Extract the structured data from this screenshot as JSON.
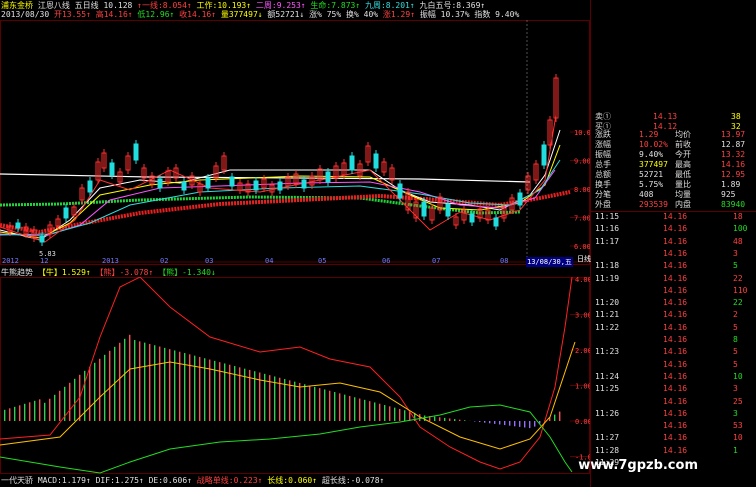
{
  "header": {
    "line1": [
      {
        "t": "浦东金桥",
        "c": "yel"
      },
      {
        "t": " 江恩八线",
        "c": "wht"
      },
      {
        "t": " 五日线 10.128",
        "c": "wht"
      },
      {
        "t": " ↑一线:8.054↑",
        "c": "red"
      },
      {
        "t": " 工作:10.193↑",
        "c": "yel"
      },
      {
        "t": " 二周:9.253↑",
        "c": "mag"
      },
      {
        "t": " 生命:7.873↑",
        "c": "grn"
      },
      {
        "t": " 九周:8.201↑",
        "c": "cyn"
      },
      {
        "t": " 九白五号:8.369↑",
        "c": "wht"
      }
    ],
    "line2": [
      {
        "t": "2013/08/30",
        "c": "wht"
      },
      {
        "t": " 开13.55↑",
        "c": "red"
      },
      {
        "t": " 高14.16↑",
        "c": "red"
      },
      {
        "t": " 低12.96↑",
        "c": "grn"
      },
      {
        "t": " 收14.16↑",
        "c": "red"
      },
      {
        "t": " 量377497↓",
        "c": "yel"
      },
      {
        "t": " 额52721↓",
        "c": "wht"
      },
      {
        "t": " 涨% 75%",
        "c": "wht"
      },
      {
        "t": " 换% 40%",
        "c": "wht"
      },
      {
        "t": " 涨1.29↑",
        "c": "red"
      },
      {
        "t": " 振幅 10.37%",
        "c": "wht"
      },
      {
        "t": " 指数 9.40%",
        "c": "wht"
      }
    ]
  },
  "top_chart": {
    "price_ticks": [
      "10.00",
      "9.00",
      "8.00",
      "7.00",
      "6.00"
    ],
    "min_label": "5.83",
    "date_ticks": [
      "2012",
      "12",
      "2013",
      "02",
      "03",
      "04",
      "05",
      "06",
      "07",
      "08",
      "09"
    ],
    "cursor_date": "13/08/30,五"
  },
  "indicator1": {
    "title": "牛熊趋势",
    "items": [
      {
        "t": "【牛】1.529↑",
        "c": "yel"
      },
      {
        "t": "【熊】-3.078↑",
        "c": "red"
      },
      {
        "t": "【熊】-1.340↓",
        "c": "grn"
      }
    ],
    "ticks": [
      "4.00",
      "3.00",
      "2.00",
      "1.00",
      "0.00",
      "-1.00"
    ]
  },
  "indicator2": {
    "items": [
      {
        "t": "一代天骄 MACD:1.179↑",
        "c": "wht"
      },
      {
        "t": " DIF:1.275↑",
        "c": "wht"
      },
      {
        "t": " DE:0.606↑",
        "c": "wht"
      },
      {
        "t": " 战略单线:0.223↑",
        "c": "red"
      },
      {
        "t": " 长线:0.060↑",
        "c": "yel"
      },
      {
        "t": " 超长线:-0.078↑",
        "c": "wht"
      }
    ]
  },
  "quote_panel": {
    "top_rows": [
      {
        "label": "卖①",
        "value": "14.13",
        "vol": "38"
      },
      {
        "label": "买①",
        "value": "14.12",
        "vol": "32"
      }
    ],
    "grid": [
      {
        "l1": "涨跌",
        "v1": "1.29",
        "l2": "均价",
        "v2": "13.97",
        "c1": "red",
        "c2": "red"
      },
      {
        "l1": "涨幅",
        "v1": "10.02%",
        "l2": "前收",
        "v2": "12.87",
        "c1": "red",
        "c2": "wht"
      },
      {
        "l1": "振幅",
        "v1": "9.40%",
        "l2": "今开",
        "v2": "13.32",
        "c1": "wht",
        "c2": "red"
      },
      {
        "l1": "总手",
        "v1": "377497",
        "l2": "最高",
        "v2": "14.16",
        "c1": "yel",
        "c2": "red"
      },
      {
        "l1": "总额",
        "v1": "52721",
        "l2": "最低",
        "v2": "12.95",
        "c1": "wht",
        "c2": "red"
      },
      {
        "l1": "换手",
        "v1": "5.75%",
        "l2": "量比",
        "v2": "1.89",
        "c1": "wht",
        "c2": "wht"
      },
      {
        "l1": "分笔",
        "v1": "408",
        "l2": "均量",
        "v2": "925",
        "c1": "wht",
        "c2": "wht"
      },
      {
        "l1": "外盘",
        "v1": "293539",
        "l2": "内盘",
        "v2": "83940",
        "c1": "red",
        "c2": "grn"
      }
    ],
    "ticks": [
      {
        "time": "11:15",
        "price": "14.16",
        "vol": "18"
      },
      {
        "time": "11:16",
        "price": "14.16",
        "vol": "100"
      },
      {
        "time": "11:17",
        "price": "14.16",
        "vol": "48"
      },
      {
        "time": "",
        "price": "14.16",
        "vol": "3"
      },
      {
        "time": "11:18",
        "price": "14.16",
        "vol": "5"
      },
      {
        "time": "11:19",
        "price": "14.16",
        "vol": "22"
      },
      {
        "time": "",
        "price": "14.16",
        "vol": "110"
      },
      {
        "time": "11:20",
        "price": "14.16",
        "vol": "22"
      },
      {
        "time": "11:21",
        "price": "14.16",
        "vol": "2"
      },
      {
        "time": "11:22",
        "price": "14.16",
        "vol": "5"
      },
      {
        "time": "",
        "price": "14.16",
        "vol": "8"
      },
      {
        "time": "11:23",
        "price": "14.16",
        "vol": "5"
      },
      {
        "time": "",
        "price": "14.16",
        "vol": "5"
      },
      {
        "time": "11:24",
        "price": "14.16",
        "vol": "10"
      },
      {
        "time": "11:25",
        "price": "14.16",
        "vol": "3"
      },
      {
        "time": "",
        "price": "14.16",
        "vol": "25"
      },
      {
        "time": "11:26",
        "price": "14.16",
        "vol": "3"
      },
      {
        "time": "",
        "price": "14.16",
        "vol": "53"
      },
      {
        "time": "11:27",
        "price": "14.16",
        "vol": "10"
      },
      {
        "time": "11:28",
        "price": "14.16",
        "vol": "1"
      },
      {
        "time": "11:29",
        "price": "",
        "vol": ""
      }
    ],
    "side_label": "日线"
  },
  "watermark": "www.7gpzb.com",
  "colors": {
    "up": "#ff3030",
    "down": "#22cc44",
    "yellow": "#ffff00",
    "white": "#ffffff",
    "grid": "#5a0000"
  }
}
